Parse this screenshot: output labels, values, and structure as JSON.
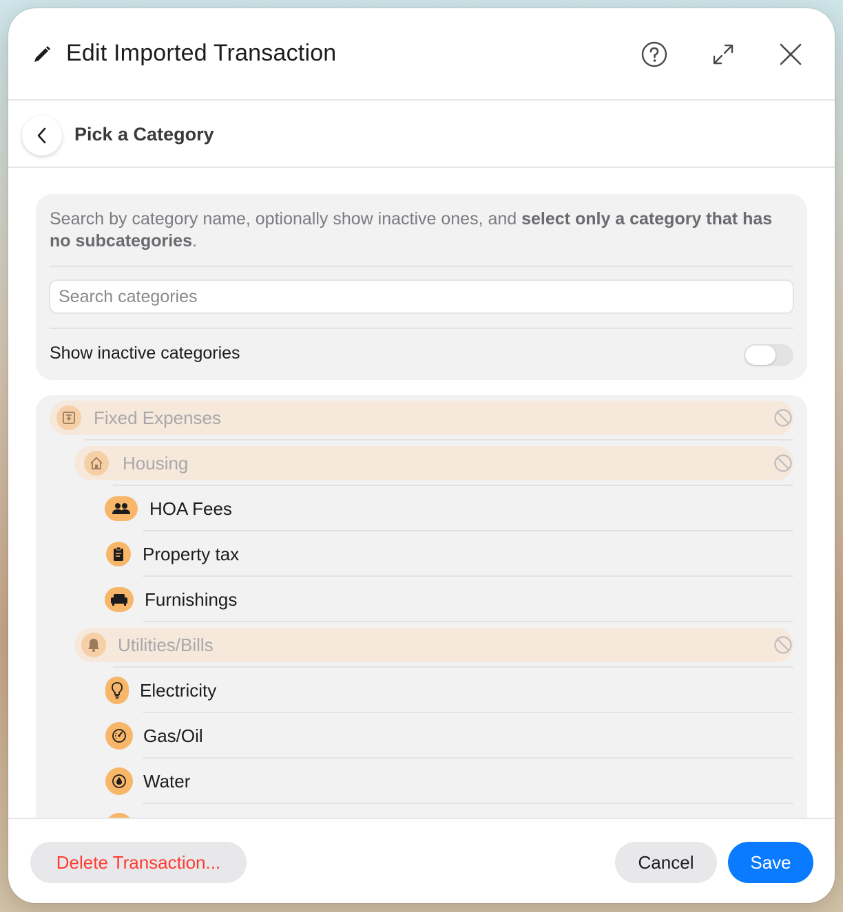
{
  "window": {
    "title": "Edit Imported Transaction",
    "icons": [
      "pencil-icon",
      "help-icon",
      "expand-icon",
      "close-icon"
    ]
  },
  "subheader": {
    "title": "Pick a Category",
    "back_icon": "chevron-left-icon"
  },
  "info": {
    "text_prefix": "Search by category name, optionally show inactive ones, and ",
    "text_bold": "select only a category that has no subcategories",
    "text_suffix": "."
  },
  "search": {
    "placeholder": "Search categories",
    "value": ""
  },
  "toggle": {
    "label": "Show inactive categories",
    "on": false
  },
  "categories": [
    {
      "label": "Fixed Expenses",
      "icon": "fixed-expenses-icon",
      "inactive": true
    },
    {
      "label": "Housing",
      "icon": "house-icon",
      "inactive": true
    },
    {
      "label": "HOA Fees",
      "icon": "people-icon",
      "inactive": false
    },
    {
      "label": "Property tax",
      "icon": "clipboard-icon",
      "inactive": false
    },
    {
      "label": "Furnishings",
      "icon": "sofa-icon",
      "inactive": false
    },
    {
      "label": "Utilities/Bills",
      "icon": "bell-icon",
      "inactive": true
    },
    {
      "label": "Electricity",
      "icon": "lightbulb-icon",
      "inactive": false
    },
    {
      "label": "Gas/Oil",
      "icon": "gauge-icon",
      "inactive": false
    },
    {
      "label": "Water",
      "icon": "water-drop-icon",
      "inactive": false
    }
  ],
  "footer": {
    "delete_label": "Delete Transaction...",
    "cancel_label": "Cancel",
    "save_label": "Save"
  },
  "colors": {
    "accent": "#0a7aff",
    "destructive": "#ff3b30",
    "category_icon": "#f7b668",
    "inactive_highlight": "#f6e8da"
  }
}
